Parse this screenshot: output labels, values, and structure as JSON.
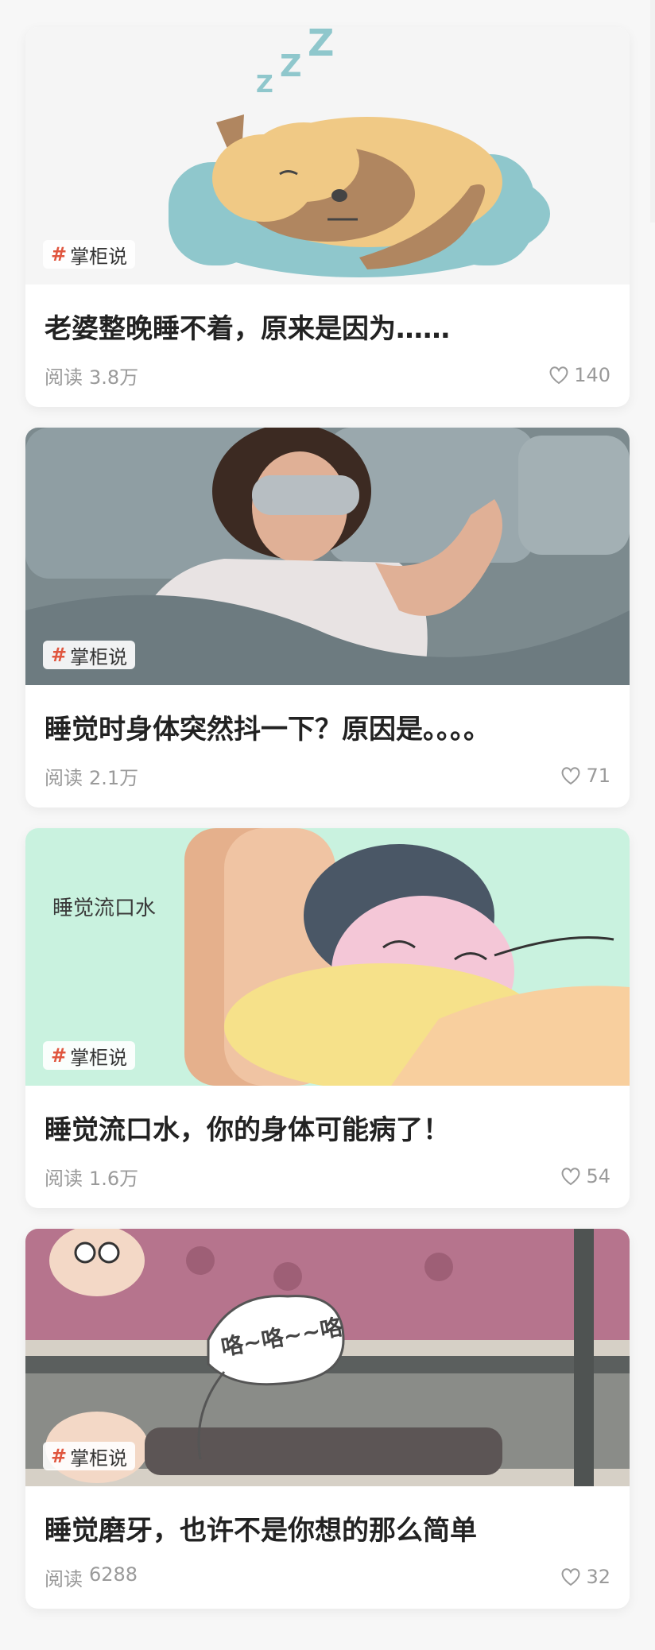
{
  "cards": [
    {
      "tag": "掌柜说",
      "title": "老婆整晚睡不着，原来是因为……",
      "read_label": "阅读",
      "reads": "3.8万",
      "likes": "140"
    },
    {
      "tag": "掌柜说",
      "title": "睡觉时身体突然抖一下？原因是。。。。",
      "read_label": "阅读",
      "reads": "2.1万",
      "likes": "71"
    },
    {
      "tag": "掌柜说",
      "title": "睡觉流口水，你的身体可能病了！",
      "read_label": "阅读",
      "reads": "1.6万",
      "likes": "54",
      "image_caption": "睡觉流口水"
    },
    {
      "tag": "掌柜说",
      "title": "睡觉磨牙，也许不是你想的那么简单",
      "read_label": "阅读",
      "reads": "6288",
      "likes": "32",
      "image_caption": "咯~咯~~咯"
    }
  ],
  "icons": {
    "like": "heart-outline-icon",
    "tag": "hash-icon"
  },
  "colors": {
    "tag_hash": "#e0563f",
    "title": "#222222",
    "meta": "#9a9a9a"
  }
}
